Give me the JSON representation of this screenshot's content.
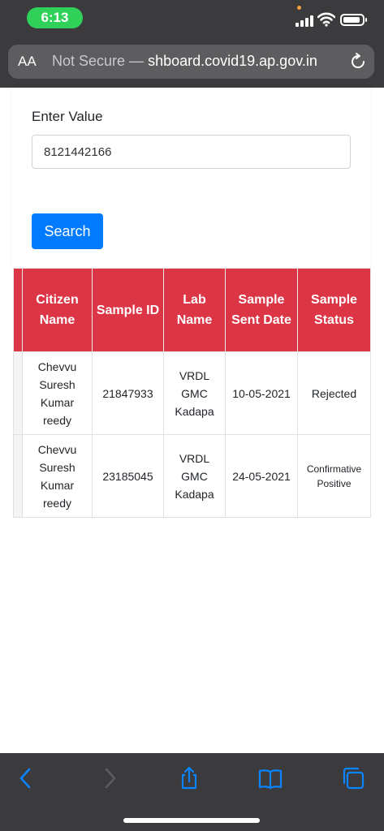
{
  "status_bar": {
    "time": "6:13"
  },
  "browser": {
    "text_size_label": "AA",
    "security_label": "Not Secure",
    "separator": " — ",
    "url": "shboard.covid19.ap.gov.in"
  },
  "form": {
    "label": "Enter Value",
    "input_value": "8121442166",
    "search_label": "Search"
  },
  "table": {
    "headers": [
      "Citizen Name",
      "Sample ID",
      "Lab Name",
      "Sample Sent Date",
      "Sample Status"
    ],
    "rows": [
      [
        "Chevvu Suresh Kumar reedy",
        "21847933",
        "VRDL GMC Kadapa",
        "10-05-2021",
        "Rejected"
      ],
      [
        "Chevvu Suresh Kumar reedy",
        "23185045",
        "VRDL GMC Kadapa",
        "24-05-2021",
        "Confirmative Positive"
      ]
    ]
  },
  "colors": {
    "header_red": "#dc3545",
    "button_blue": "#007bff",
    "toolbar_blue": "#0a84ff",
    "time_pill_green": "#2fd158"
  },
  "toolbar": {
    "icons": [
      "back-icon",
      "forward-icon",
      "share-icon",
      "bookmarks-icon",
      "tabs-icon"
    ]
  }
}
